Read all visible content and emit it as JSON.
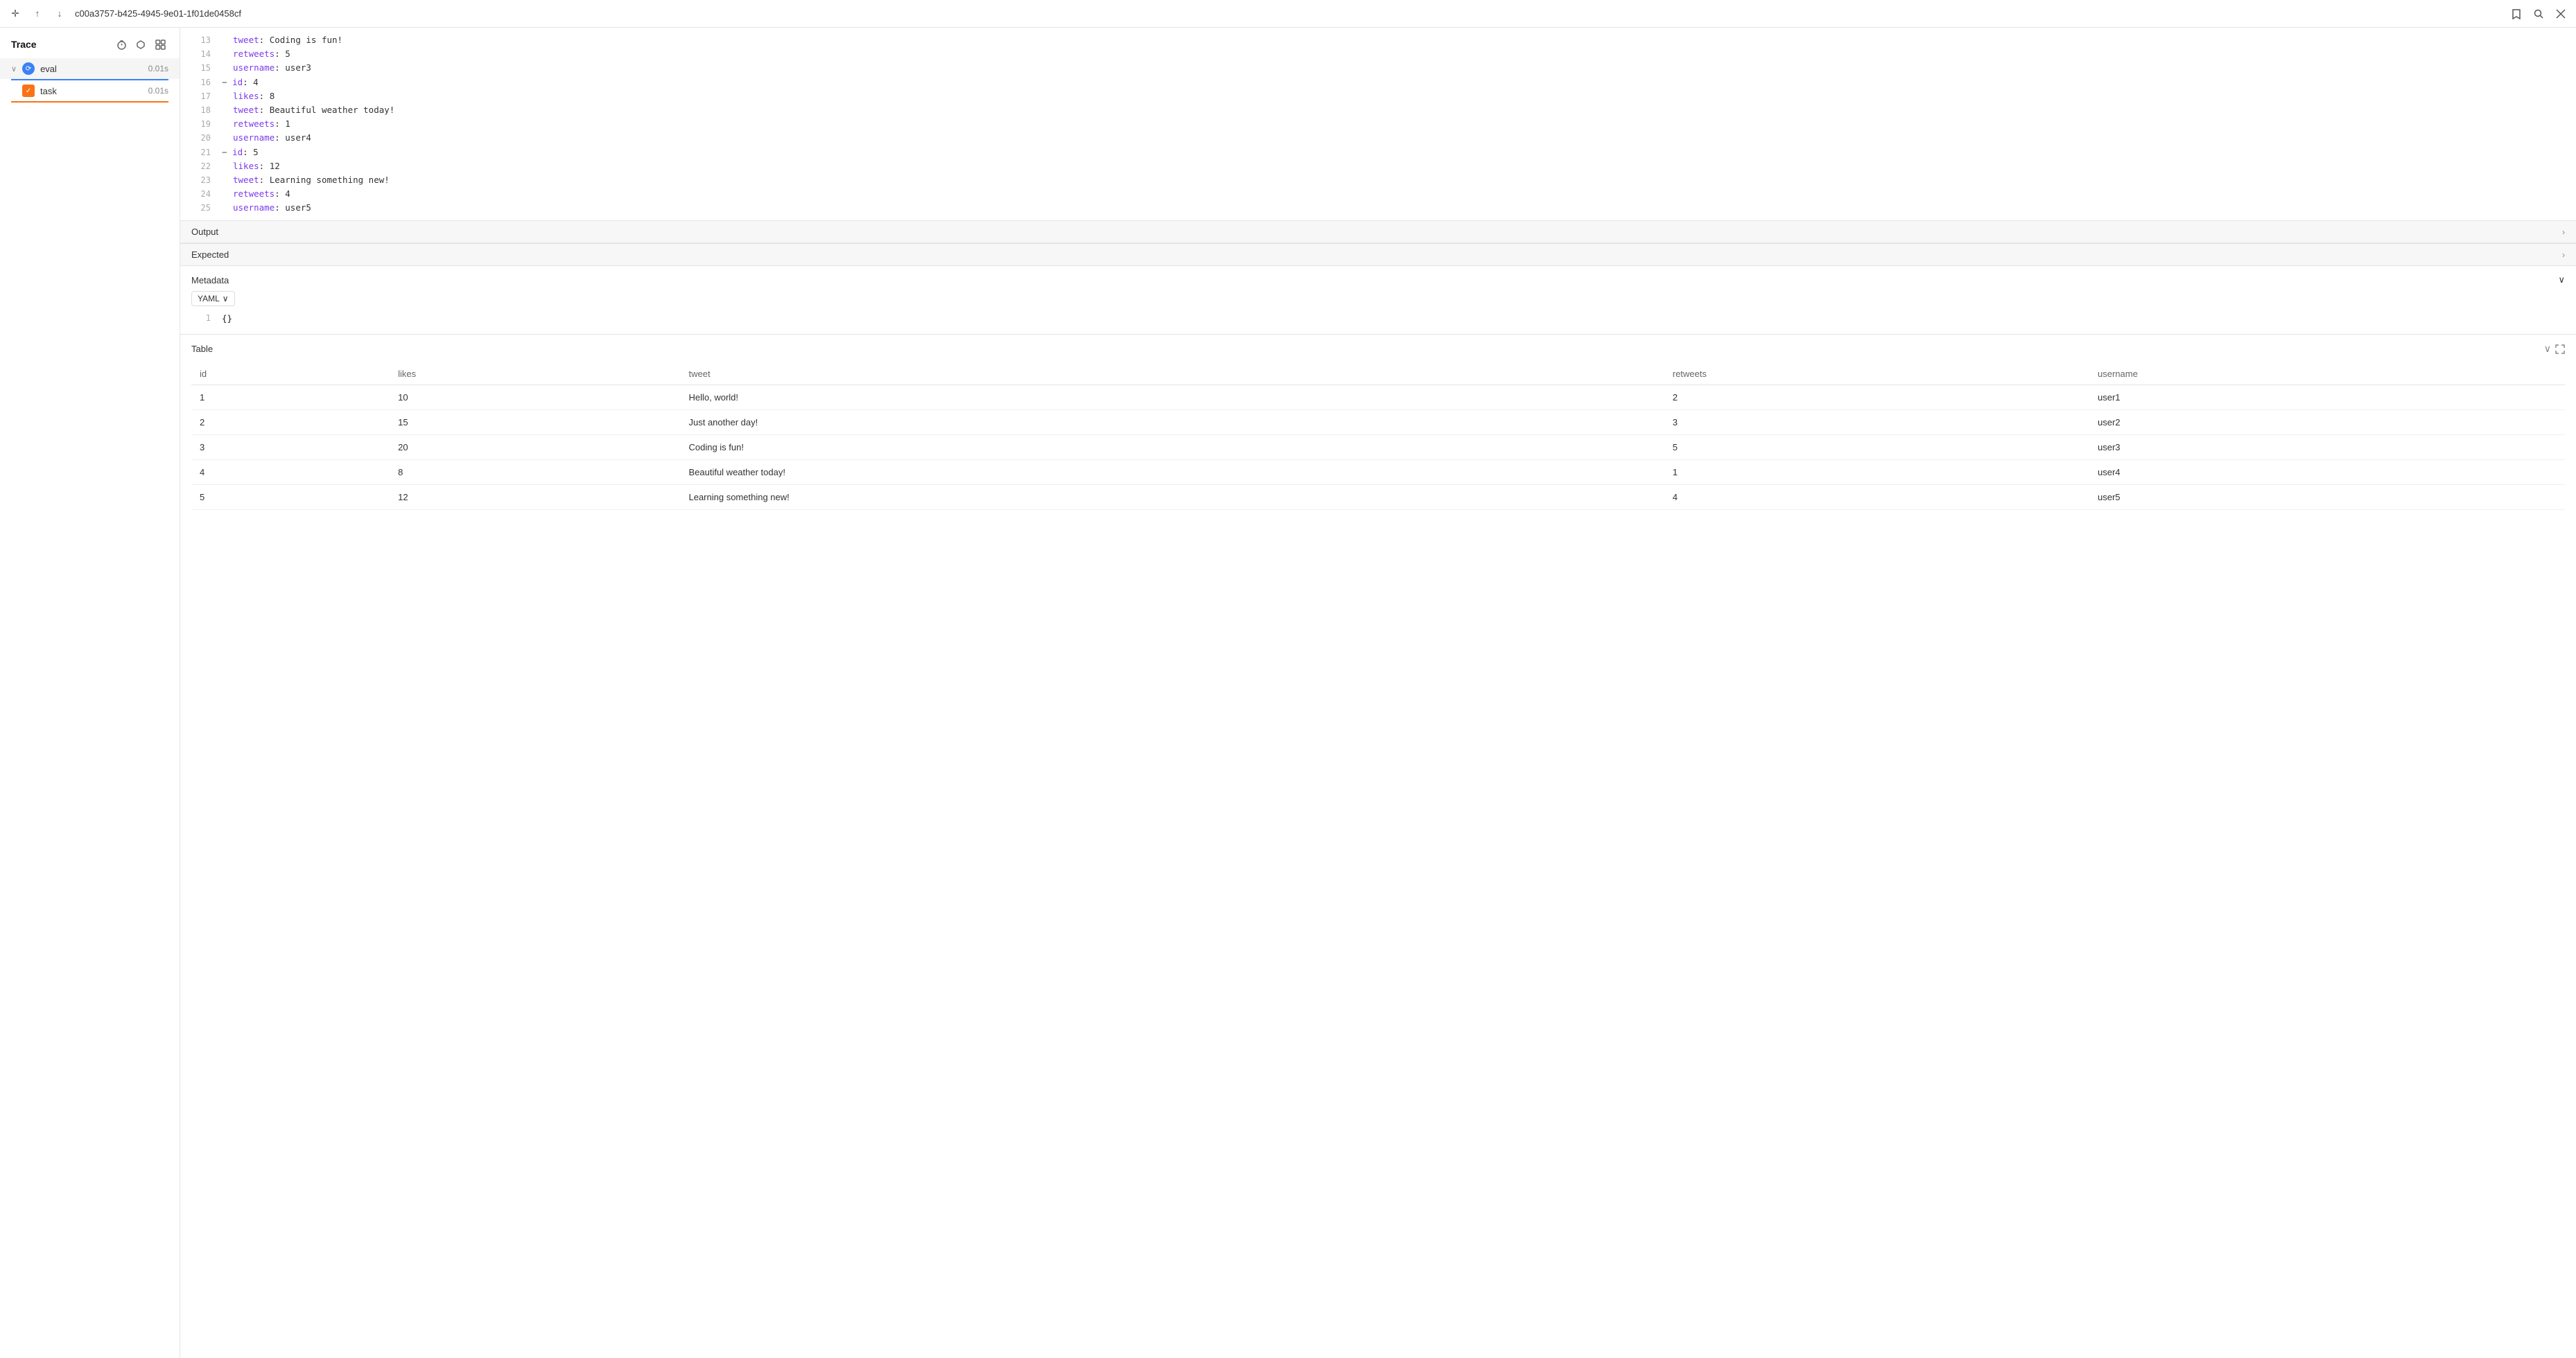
{
  "topbar": {
    "nav_up_label": "↑",
    "nav_down_label": "↓",
    "trace_id": "c00a3757-b425-4945-9e01-1f01de0458cf",
    "bookmark_icon": "bookmark",
    "search_icon": "search",
    "close_icon": "close"
  },
  "sidebar": {
    "title": "Trace",
    "timer_icon": "timer",
    "expand_icon": "expand",
    "grid_icon": "grid",
    "items": [
      {
        "id": "eval",
        "label": "eval",
        "time": "0.01s",
        "type": "eval",
        "color": "blue",
        "active": true
      },
      {
        "id": "task",
        "label": "task",
        "time": "0.01s",
        "type": "task",
        "color": "orange",
        "active": false
      }
    ]
  },
  "code": {
    "lines": [
      {
        "num": "13",
        "content": "  tweet: Coding is fun!",
        "indent": 1
      },
      {
        "num": "14",
        "content": "  retweets: 5",
        "indent": 1
      },
      {
        "num": "15",
        "content": "  username: user3",
        "indent": 1
      },
      {
        "num": "16",
        "content": "- id: 4",
        "indent": 0,
        "dash": true
      },
      {
        "num": "17",
        "content": "  likes: 8",
        "indent": 1
      },
      {
        "num": "18",
        "content": "  tweet: Beautiful weather today!",
        "indent": 1
      },
      {
        "num": "19",
        "content": "  retweets: 1",
        "indent": 1
      },
      {
        "num": "20",
        "content": "  username: user4",
        "indent": 1
      },
      {
        "num": "21",
        "content": "- id: 5",
        "indent": 0,
        "dash": true
      },
      {
        "num": "22",
        "content": "  likes: 12",
        "indent": 1
      },
      {
        "num": "23",
        "content": "  tweet: Learning something new!",
        "indent": 1
      },
      {
        "num": "24",
        "content": "  retweets: 4",
        "indent": 1
      },
      {
        "num": "25",
        "content": "  username: user5",
        "indent": 1
      }
    ]
  },
  "sections": {
    "output": {
      "label": "Output",
      "chevron": "›"
    },
    "expected": {
      "label": "Expected",
      "chevron": "›"
    },
    "metadata": {
      "label": "Metadata",
      "chevron": "∨",
      "format": "YAML",
      "format_chevron": "∨",
      "code_line_num": "1",
      "code_content": "{}"
    }
  },
  "table": {
    "label": "Table",
    "chevron": "∨",
    "expand_icon": "expand",
    "columns": [
      "id",
      "likes",
      "tweet",
      "retweets",
      "username"
    ],
    "rows": [
      {
        "id": "1",
        "likes": "10",
        "tweet": "Hello, world!",
        "retweets": "2",
        "username": "user1"
      },
      {
        "id": "2",
        "likes": "15",
        "tweet": "Just another day!",
        "retweets": "3",
        "username": "user2"
      },
      {
        "id": "3",
        "likes": "20",
        "tweet": "Coding is fun!",
        "retweets": "5",
        "username": "user3"
      },
      {
        "id": "4",
        "likes": "8",
        "tweet": "Beautiful weather today!",
        "retweets": "1",
        "username": "user4"
      },
      {
        "id": "5",
        "likes": "12",
        "tweet": "Learning something new!",
        "retweets": "4",
        "username": "user5"
      }
    ]
  }
}
